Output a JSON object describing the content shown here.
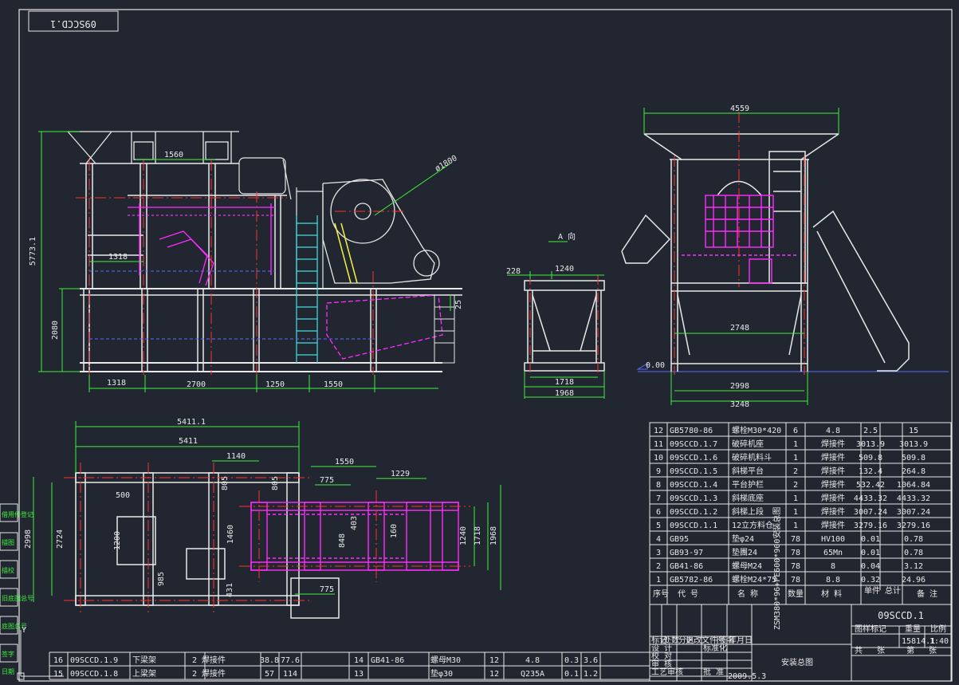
{
  "header_box": "09SCCD.1",
  "dims_front": {
    "d4559": "4559",
    "d1560": "1560",
    "d1800": "ø1800",
    "d5773": "5773.1",
    "d1318_top": "1318",
    "d2080": "2080",
    "d25": "25",
    "d1318": "1318",
    "d2700": "2700",
    "d1250": "1250",
    "d1550": "1550"
  },
  "view_a": {
    "label": "A 向",
    "d228": "228",
    "d1240": "1240",
    "d1718": "1718",
    "d1968": "1968",
    "elev": "0.00"
  },
  "dims_side": {
    "d2748": "2748",
    "d2998": "2998",
    "d3248": "3248"
  },
  "dims_plan": {
    "d5411_1": "5411.1",
    "d5411": "5411",
    "d1140": "1140",
    "d1550": "1550",
    "d775": "775",
    "d1229": "1229",
    "d500": "500",
    "d805a": "805",
    "d805b": "805",
    "d1200": "1200",
    "d1460": "1460",
    "d848": "848",
    "d403": "403",
    "d160": "160",
    "d1240": "1240",
    "d1718": "1718",
    "d1968": "1968",
    "d2998": "2998",
    "d2724": "2724",
    "d985": "985",
    "d431": "431",
    "d775b": "775"
  },
  "bom_rows": [
    [
      "12",
      "GB5780-86",
      "螺栓M30*420",
      "6",
      "4.8",
      "2.5",
      "15"
    ],
    [
      "11",
      "09SCCD.1.7",
      "破碎机座",
      "1",
      "焊接件",
      "3013.9",
      "3013.9"
    ],
    [
      "10",
      "09SCCD.1.6",
      "破碎机料斗",
      "1",
      "焊接件",
      "509.8",
      "509.8"
    ],
    [
      "9",
      "09SCCD.1.5",
      "斜梯平台",
      "2",
      "焊接件",
      "132.4",
      "264.8"
    ],
    [
      "8",
      "09SCCD.1.4",
      "平台护栏",
      "2",
      "焊接件",
      "532.42",
      "1064.84"
    ],
    [
      "7",
      "09SCCD.1.3",
      "斜梯底座",
      "1",
      "焊接件",
      "4433.32",
      "4433.32"
    ],
    [
      "6",
      "09SCCD.1.2",
      "斜梯上段",
      "1",
      "焊接件",
      "3007.24",
      "3007.24"
    ],
    [
      "5",
      "09SCCD.1.1",
      "12立方料仓",
      "1",
      "焊接件",
      "3279.16",
      "3279.16"
    ],
    [
      "4",
      "GB95",
      "垫φ24",
      "78",
      "HV100",
      "0.01",
      "0.78"
    ],
    [
      "3",
      "GB93-97",
      "垫團24",
      "78",
      "65Mn",
      "0.01",
      "0.78"
    ],
    [
      "2",
      "GB41-86",
      "螺母M24",
      "78",
      "8",
      "0.04",
      "3.12"
    ],
    [
      "1",
      "GB5782-86",
      "螺栓M24*75",
      "78",
      "8.8",
      "0.32",
      "24.96"
    ]
  ],
  "bom_header": [
    "序号",
    "代 号",
    "名 称",
    "数量",
    "材 料",
    "单件 总计",
    "备 注"
  ],
  "bom_bottom_left": [
    [
      "16",
      "09SCCD.1.9",
      "下梁架",
      "2",
      "焊接件",
      "38.8",
      "77.6"
    ],
    [
      "15",
      "09SCCD.1.8",
      "上梁架",
      "2",
      "焊接件",
      "57",
      "114"
    ]
  ],
  "bom_bottom_right": [
    [
      "14",
      "GB41-86",
      "螺母M30",
      "12",
      "4.8",
      "0.3",
      "3.6"
    ],
    [
      "13",
      "",
      "垫φ30",
      "12",
      "Q235A",
      "0.1",
      "1.2"
    ]
  ],
  "title_block": {
    "drawing_title": "ZSM380*96+PE600*900安装总图",
    "drawing_no": "09SCCD.1",
    "subtitle": "安装总图",
    "weight": "15814.1",
    "scale": "1:40",
    "date": "2009.5.3",
    "sign_rows": [
      "标记",
      "设 计",
      "校 对",
      "审 核",
      "工艺审核"
    ],
    "sign_cols": [
      "处数",
      "分区",
      "更改文件号",
      "签名",
      "年月日"
    ],
    "std": "标准化",
    "approve": "批 准",
    "stage_hdr": [
      "图样标记",
      "重量",
      "比例"
    ],
    "sheet": [
      "共",
      "张",
      "第",
      "张"
    ]
  },
  "side_tabs": [
    "借用件登记",
    "描图",
    "描校",
    "旧底图总号",
    "底图总号",
    "签字",
    "日期"
  ],
  "axis_label": "Y",
  "colors": {
    "bg": "#222630",
    "frame": "#e8e8e8",
    "green": "#3cf03c",
    "magenta": "#ff2cff",
    "red": "#ff3030",
    "cyan": "#40e0e0",
    "yellow": "#f0f040",
    "blue": "#5a6cff"
  }
}
